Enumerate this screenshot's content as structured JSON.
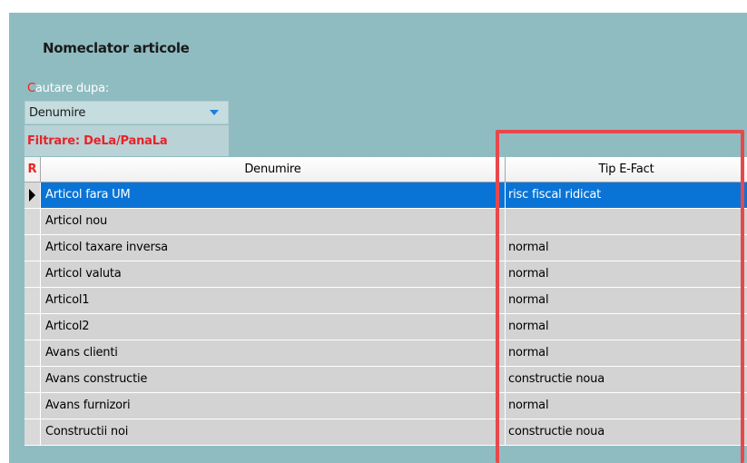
{
  "panel": {
    "title": "Nomeclator articole",
    "search_label_first": "C",
    "search_label_rest": "autare dupa:",
    "search_value": "Denumire",
    "filter_label": "Filtrare: DeLa/PanaLa"
  },
  "grid": {
    "r_header": "R",
    "columns": [
      "Denumire",
      "Tip E-Fact"
    ],
    "rows": [
      {
        "denumire": "Articol fara UM",
        "tip": "risc fiscal ridicat",
        "selected": true
      },
      {
        "denumire": "Articol nou",
        "tip": ""
      },
      {
        "denumire": "Articol taxare inversa",
        "tip": "normal"
      },
      {
        "denumire": "Articol valuta",
        "tip": "normal"
      },
      {
        "denumire": "Articol1",
        "tip": "normal"
      },
      {
        "denumire": "Articol2",
        "tip": "normal"
      },
      {
        "denumire": "Avans clienti",
        "tip": "normal"
      },
      {
        "denumire": "Avans constructie",
        "tip": "constructie noua"
      },
      {
        "denumire": "Avans furnizori",
        "tip": "normal"
      },
      {
        "denumire": "Constructii noi",
        "tip": "constructie noua"
      }
    ]
  },
  "colors": {
    "panel_bg": "#8fbcc1",
    "selection": "#0a74d6",
    "accent_red": "#e8222a",
    "highlight_border": "#e8484c"
  }
}
